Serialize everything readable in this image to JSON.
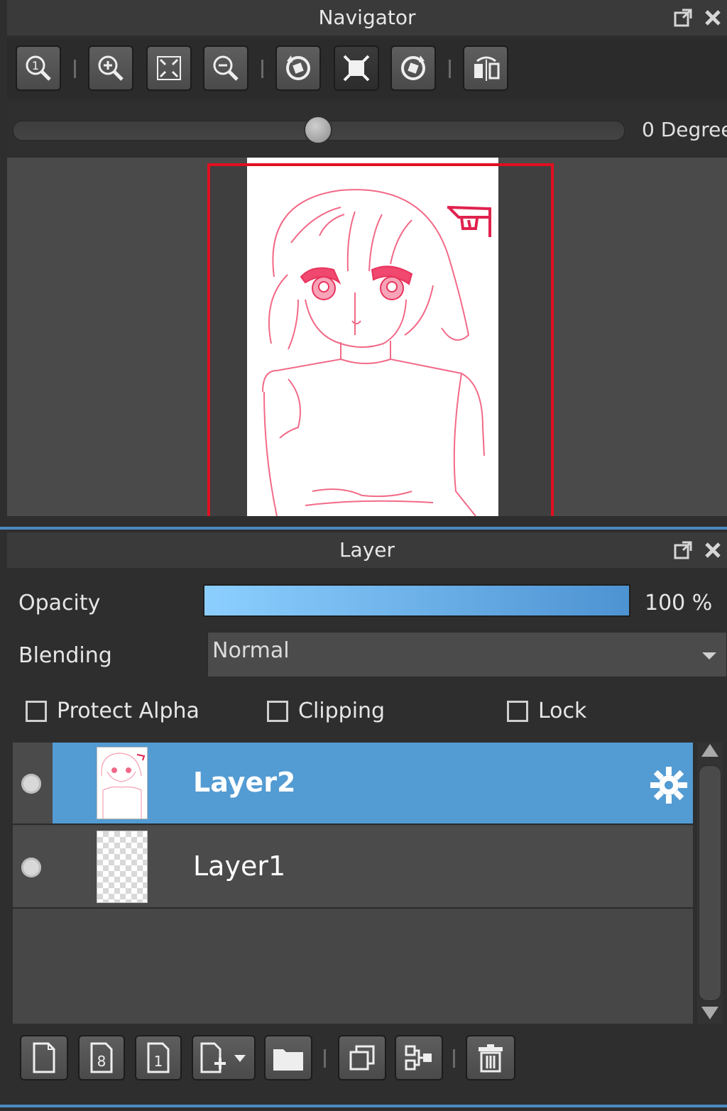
{
  "navigator": {
    "title": "Navigator",
    "toolbar": [
      {
        "name": "zoom-actual-size-icon",
        "active": false
      },
      {
        "name": "zoom-in-icon",
        "active": false
      },
      {
        "name": "fit-to-window-icon",
        "active": false
      },
      {
        "name": "zoom-out-icon",
        "active": false
      },
      {
        "name": "rotate-left-icon",
        "active": false
      },
      {
        "name": "reset-rotation-icon",
        "active": true
      },
      {
        "name": "rotate-right-icon",
        "active": false
      },
      {
        "name": "flip-horizontal-icon",
        "active": false
      }
    ],
    "rotation_label": "0 Degree",
    "rotation_degrees": 0
  },
  "layer_panel": {
    "title": "Layer",
    "opacity_label": "Opacity",
    "opacity_value": "100 %",
    "opacity_fraction": 1.0,
    "blending_label": "Blending",
    "blending_value": "Normal",
    "checkboxes": {
      "protect_alpha": {
        "label": "Protect Alpha",
        "checked": false
      },
      "clipping": {
        "label": "Clipping",
        "checked": false
      },
      "lock": {
        "label": "Lock",
        "checked": false
      }
    },
    "layers": [
      {
        "name": "Layer2",
        "selected": true,
        "visible": true
      },
      {
        "name": "Layer1",
        "selected": false,
        "visible": true
      }
    ],
    "bottom_toolbar": [
      "new-layer-icon",
      "new-8bit-layer-icon",
      "new-1bit-layer-icon",
      "add-layer-dropdown-icon",
      "new-folder-icon",
      "duplicate-layer-icon",
      "merge-down-icon",
      "delete-layer-icon"
    ]
  },
  "colors": {
    "accent": "#539bd3",
    "panel_bg": "#2e2e2e",
    "preview_frame": "#e01020",
    "sketch_line": "#f26a88"
  }
}
